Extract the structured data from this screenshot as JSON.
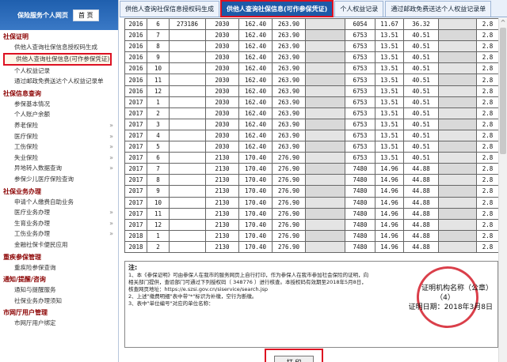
{
  "sidebar": {
    "title": "保险服务个人网页",
    "home": "首 页",
    "sections": [
      {
        "title": "社保证明",
        "items": [
          {
            "label": "供他人查询社保信息授权码生成"
          },
          {
            "label": "供他人查询社保信息(可作参保凭证)",
            "selected": true
          },
          {
            "label": "个人权益记录"
          },
          {
            "label": "通过邮政免费送达个人权益记录单"
          }
        ]
      },
      {
        "title": "社保信息查询",
        "items": [
          {
            "label": "参保基本情况"
          },
          {
            "label": "个人账户余额"
          },
          {
            "label": "养老保险",
            "arrow": "»"
          },
          {
            "label": "医疗保险",
            "arrow": "»"
          },
          {
            "label": "工伤保险",
            "arrow": "»"
          },
          {
            "label": "失业保险",
            "arrow": "»"
          },
          {
            "label": "异地转入数据查询",
            "arrow": "»"
          },
          {
            "label": "参保少儿医疗保险查询"
          }
        ]
      },
      {
        "title": "社保业务办理",
        "items": [
          {
            "label": "申请个人缴费自助业务"
          },
          {
            "label": "医疗业务办理",
            "arrow": "»"
          },
          {
            "label": "生育业务办理",
            "arrow": "»"
          },
          {
            "label": "工伤业务办理",
            "arrow": "»"
          },
          {
            "label": "金融社保卡便民应用"
          }
        ]
      },
      {
        "title": "重疾参保管理",
        "items": [
          {
            "label": "重疾险参保查询"
          }
        ]
      },
      {
        "title": "通知/提醒/咨询",
        "items": [
          {
            "label": "通知与提醒服务"
          },
          {
            "label": "社保业务办理须知"
          }
        ]
      },
      {
        "title": "市网厅用户管理",
        "items": [
          {
            "label": "市网厅用户绑定"
          }
        ]
      }
    ]
  },
  "tabs": [
    {
      "label": "供他人查询社保信息授权码生成",
      "active": false
    },
    {
      "label": "供他人查询社保信息(可作参保凭证)",
      "active": true
    },
    {
      "label": "个人权益记录",
      "active": false
    },
    {
      "label": "通过邮政免费送达个人权益记录单",
      "active": false
    }
  ],
  "table_rows": [
    [
      "2016",
      "6",
      "273186",
      "2030",
      "162.40",
      "263.90",
      "",
      "6054",
      "11.67",
      "36.32",
      "",
      "2.8"
    ],
    [
      "2016",
      "7",
      "",
      "2030",
      "162.40",
      "263.90",
      "",
      "6753",
      "13.51",
      "40.51",
      "",
      "2.8"
    ],
    [
      "2016",
      "8",
      "",
      "2030",
      "162.40",
      "263.90",
      "",
      "6753",
      "13.51",
      "40.51",
      "",
      "2.8"
    ],
    [
      "2016",
      "9",
      "",
      "2030",
      "162.40",
      "263.90",
      "",
      "6753",
      "13.51",
      "40.51",
      "",
      "2.8"
    ],
    [
      "2016",
      "10",
      "",
      "2030",
      "162.40",
      "263.90",
      "",
      "6753",
      "13.51",
      "40.51",
      "",
      "2.8"
    ],
    [
      "2016",
      "11",
      "",
      "2030",
      "162.40",
      "263.90",
      "",
      "6753",
      "13.51",
      "40.51",
      "",
      "2.8"
    ],
    [
      "2016",
      "12",
      "",
      "2030",
      "162.40",
      "263.90",
      "",
      "6753",
      "13.51",
      "40.51",
      "",
      "2.8"
    ],
    [
      "2017",
      "1",
      "",
      "2030",
      "162.40",
      "263.90",
      "",
      "6753",
      "13.51",
      "40.51",
      "",
      "2.8"
    ],
    [
      "2017",
      "2",
      "",
      "2030",
      "162.40",
      "263.90",
      "",
      "6753",
      "13.51",
      "40.51",
      "",
      "2.8"
    ],
    [
      "2017",
      "3",
      "",
      "2030",
      "162.40",
      "263.90",
      "",
      "6753",
      "13.51",
      "40.51",
      "",
      "2.8"
    ],
    [
      "2017",
      "4",
      "",
      "2030",
      "162.40",
      "263.90",
      "",
      "6753",
      "13.51",
      "40.51",
      "",
      "2.8"
    ],
    [
      "2017",
      "5",
      "",
      "2030",
      "162.40",
      "263.90",
      "",
      "6753",
      "13.51",
      "40.51",
      "",
      "2.8"
    ],
    [
      "2017",
      "6",
      "",
      "2130",
      "170.40",
      "276.90",
      "",
      "6753",
      "13.51",
      "40.51",
      "",
      "2.8"
    ],
    [
      "2017",
      "7",
      "",
      "2130",
      "170.40",
      "276.90",
      "",
      "7480",
      "14.96",
      "44.88",
      "",
      "2.8"
    ],
    [
      "2017",
      "8",
      "",
      "2130",
      "170.40",
      "276.90",
      "",
      "7480",
      "14.96",
      "44.88",
      "",
      "2.8"
    ],
    [
      "2017",
      "9",
      "",
      "2130",
      "170.40",
      "276.90",
      "",
      "7480",
      "14.96",
      "44.88",
      "",
      "2.8"
    ],
    [
      "2017",
      "10",
      "",
      "2130",
      "170.40",
      "276.90",
      "",
      "7480",
      "14.96",
      "44.88",
      "",
      "2.8"
    ],
    [
      "2017",
      "11",
      "",
      "2130",
      "170.40",
      "276.90",
      "",
      "7480",
      "14.96",
      "44.88",
      "",
      "2.8"
    ],
    [
      "2017",
      "12",
      "",
      "2130",
      "170.40",
      "276.90",
      "",
      "7480",
      "14.96",
      "44.88",
      "",
      "2.8"
    ],
    [
      "2018",
      "1",
      "",
      "2130",
      "170.40",
      "276.90",
      "",
      "7480",
      "14.96",
      "44.88",
      "",
      "2.8"
    ],
    [
      "2018",
      "2",
      "",
      "2130",
      "170.40",
      "276.90",
      "",
      "7480",
      "14.96",
      "44.88",
      "",
      "2.8"
    ]
  ],
  "blurred_columns": [
    6,
    10
  ],
  "notes": {
    "title": "注:",
    "lines": [
      "1、本《参保证明》可由参保人在我市的服务网页上自行打印，作为参保人在我市参加社会保险的证明，向",
      "相关部门提供，查验部门可通过下列授权码（ 348776 ）进行核查。本授权码有效期至2018年5月8日，",
      "核查网页地址：https://e.szsi.gov.cn/siservice/search.jsp",
      "2、上述\"缴费明细\"表中带\"*\"标识为补缴，空行为断缴。",
      "3、表中\"单位编号\"对应的单位名称："
    ]
  },
  "certify": {
    "org_label": "证明机构名称（公章）",
    "org_value": "（4）",
    "date_label": "证明日期：2018年3月8日"
  },
  "print_button": "打 印"
}
